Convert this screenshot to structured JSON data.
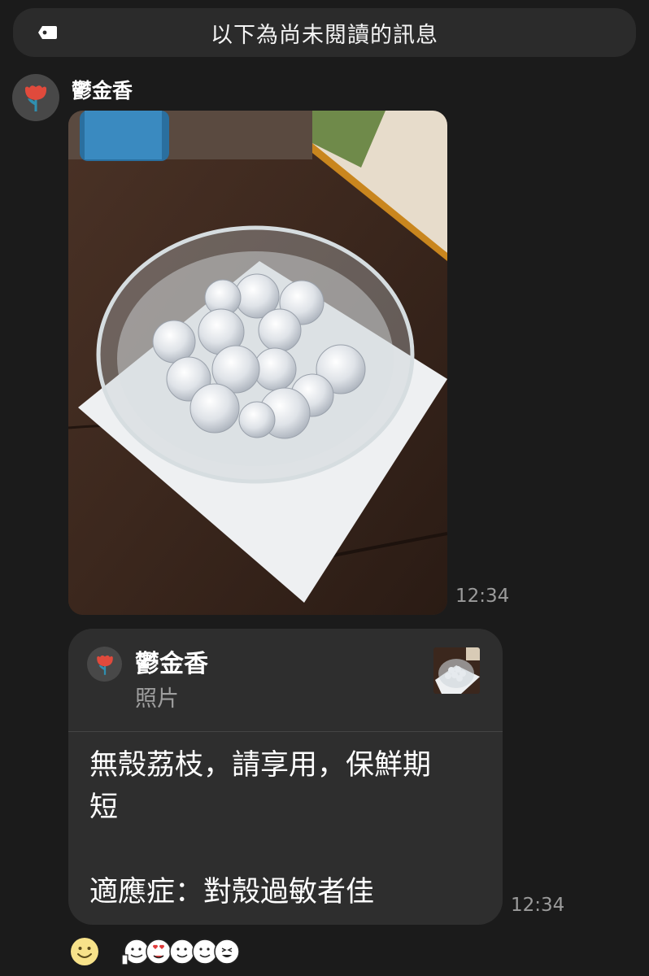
{
  "banner": {
    "text": "以下為尚未閱讀的訊息",
    "icon": "tag-icon"
  },
  "sender": {
    "name": "鬱金香",
    "avatar_icon": "tulip-icon"
  },
  "photo_message": {
    "time": "12:34",
    "image_desc_icon": "photo-image"
  },
  "reply_message": {
    "quote": {
      "name": "鬱金香",
      "type": "照片"
    },
    "text": "無殼荔枝，請享用，保鮮期\n短\n\n適應症：對殼過敏者佳",
    "time": "12:34"
  },
  "reactions": {
    "add_icon": "smiley-icon",
    "stickers_icon": "emoji-faces-icon"
  },
  "colors": {
    "background": "#1b1b1b",
    "bubble": "#2e2e2e",
    "banner": "#2b2b2b",
    "tulip_red": "#e04a3c",
    "tulip_stem": "#2f8fb0",
    "timestamp": "#9b9b9b"
  }
}
